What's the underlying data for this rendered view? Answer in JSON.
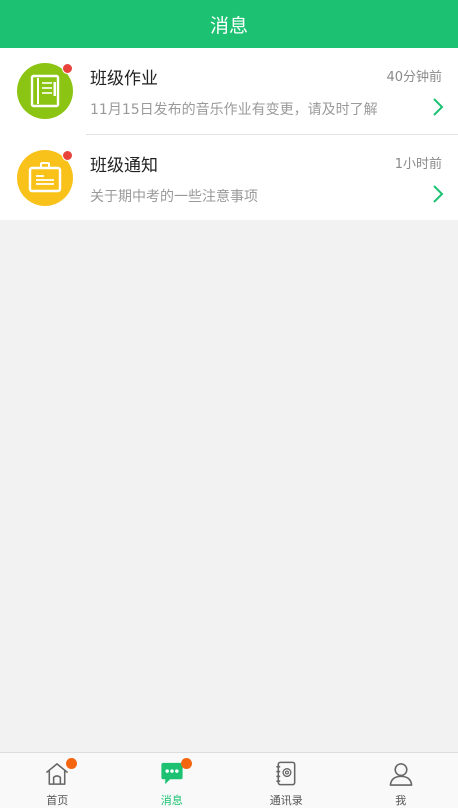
{
  "header": {
    "title": "消息"
  },
  "messages": [
    {
      "title": "班级作业",
      "time": "40分钟前",
      "preview": "11月15日发布的音乐作业有变更，请及时了解",
      "icon": "notebook-icon",
      "icon_bg": "#8cc414",
      "unread": true
    },
    {
      "title": "班级通知",
      "time": "1小时前",
      "preview": "关于期中考的一些注意事项",
      "icon": "notice-board-icon",
      "icon_bg": "#f9c21b",
      "unread": true
    }
  ],
  "tabbar": {
    "tabs": [
      {
        "label": "首页",
        "icon": "home-icon",
        "badge": true,
        "active": false
      },
      {
        "label": "消息",
        "icon": "chat-bubble-icon",
        "badge": true,
        "active": true
      },
      {
        "label": "通讯录",
        "icon": "contacts-book-icon",
        "badge": false,
        "active": false
      },
      {
        "label": "我",
        "icon": "person-icon",
        "badge": false,
        "active": false
      }
    ]
  },
  "colors": {
    "brand_green": "#1cc272",
    "unread_dot": "#e8433a",
    "tab_badge": "#f5650f",
    "background": "#f2f2f2"
  }
}
